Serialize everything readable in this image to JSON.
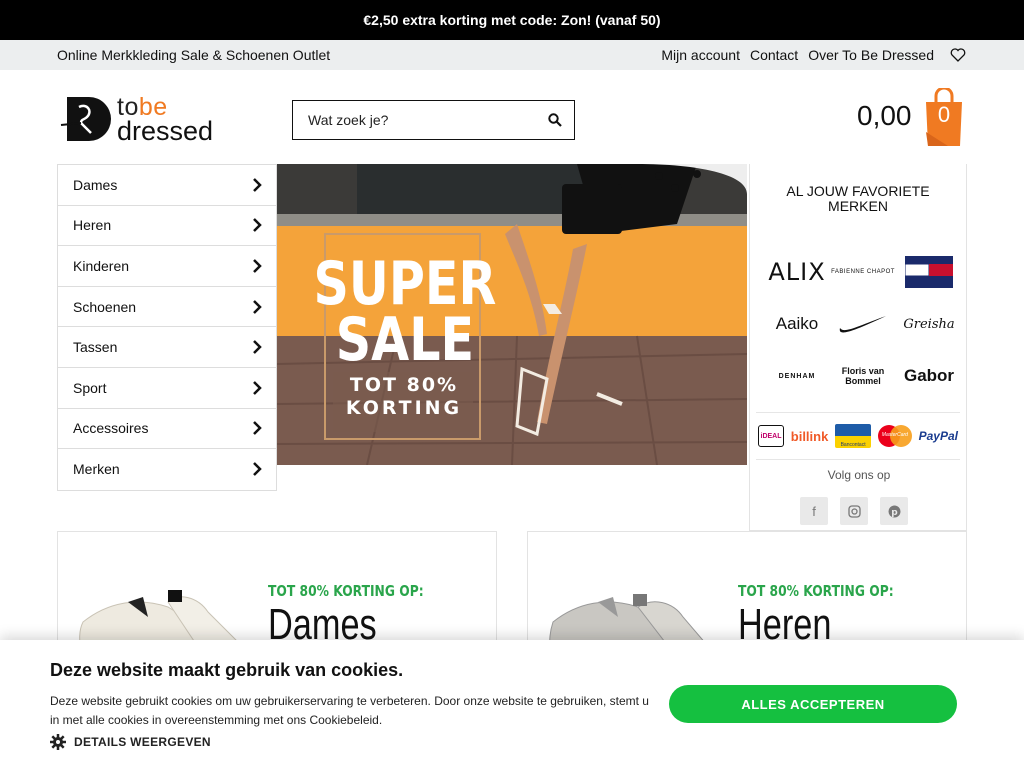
{
  "promo_bar": {
    "text": "€2,50 extra korting met code: Zon! (vanaf 50)"
  },
  "topbar": {
    "tagline": "Online Merkkleding Sale & Schoenen Outlet",
    "links": [
      "Mijn account",
      "Contact",
      "Over To Be Dressed"
    ],
    "wishlist_icon": "heart-icon"
  },
  "logo": {
    "line1_a": "to",
    "line1_b": "be",
    "line2": "dressed",
    "accent": "#f07a22"
  },
  "search": {
    "placeholder": "Wat zoek je?"
  },
  "cart": {
    "total": "0,00",
    "count": "0",
    "color": "#f07a22"
  },
  "menu": {
    "items": [
      "Dames",
      "Heren",
      "Kinderen",
      "Schoenen",
      "Tassen",
      "Sport",
      "Accessoires",
      "Merken"
    ]
  },
  "banner": {
    "line1": "SUPER",
    "line2": "SALE",
    "line3": "TOT 80%",
    "line4": "KORTING"
  },
  "brands": {
    "title": "AL JOUW FAVORIETE MERKEN",
    "logos": [
      "ALIX",
      "Fabienne Chapot",
      "Tommy Hilfiger",
      "Aaiko",
      "Nike",
      "Greisha",
      "Denham",
      "Floris van Bommel",
      "Gabor"
    ],
    "payment": [
      "iDEAL",
      "billink",
      "Bancontact",
      "MasterCard",
      "PayPal"
    ],
    "follow": "Volg ons op",
    "socials": [
      "facebook-icon",
      "instagram-icon",
      "pinterest-icon"
    ]
  },
  "promo_cards": [
    {
      "tag": "TOT 80% KORTING OP:",
      "category": "Dames"
    },
    {
      "tag": "TOT 80% KORTING OP:",
      "category": "Heren"
    }
  ],
  "cookie": {
    "title": "Deze website maakt gebruik van cookies.",
    "text": "Deze website gebruikt cookies om uw gebruikerservaring te verbeteren. Door onze website te gebruiken, stemt u in met alle cookies in overeenstemming met ons Cookiebeleid.",
    "details": "DETAILS WEERGEVEN",
    "accept": "ALLES ACCEPTEREN",
    "accept_color": "#15c040"
  }
}
